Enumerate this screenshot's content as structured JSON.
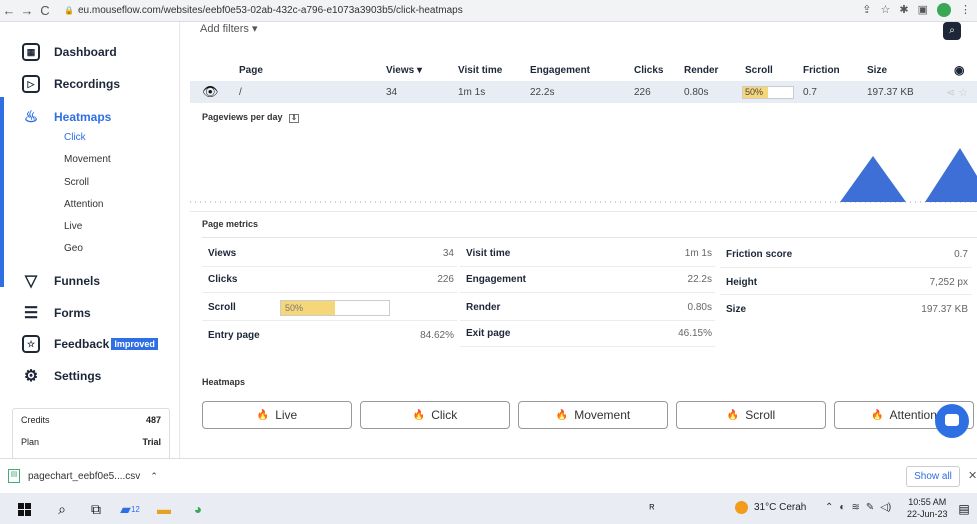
{
  "browser": {
    "url": "eu.mouseflow.com/websites/eebf0e53-02ab-432c-a796-e1073a3903b5/click-heatmaps"
  },
  "sidebar": {
    "items": [
      {
        "label": "Dashboard",
        "icon": "dashboard-icon"
      },
      {
        "label": "Recordings",
        "icon": "recordings-icon"
      },
      {
        "label": "Heatmaps",
        "icon": "heatmaps-icon"
      },
      {
        "label": "Funnels",
        "icon": "funnels-icon"
      },
      {
        "label": "Forms",
        "icon": "forms-icon"
      },
      {
        "label": "Feedback",
        "icon": "feedback-icon",
        "badge": "Improved"
      },
      {
        "label": "Settings",
        "icon": "settings-icon"
      }
    ],
    "heatmap_subitems": [
      "Click",
      "Movement",
      "Scroll",
      "Attention",
      "Live",
      "Geo"
    ],
    "credits": {
      "label": "Credits",
      "value": "487",
      "plan_label": "Plan",
      "plan_value": "Trial"
    }
  },
  "main": {
    "add_filters": "Add filters ▾",
    "table": {
      "headers": [
        "Page",
        "Views ▾",
        "Visit time",
        "Engagement",
        "Clicks",
        "Render",
        "Scroll",
        "Friction",
        "Size"
      ],
      "row": {
        "page": "/",
        "views": "34",
        "visit_time": "1m 1s",
        "engagement": "22.2s",
        "clicks": "226",
        "render": "0.80s",
        "scroll": "50%",
        "scroll_fraction": 0.5,
        "friction": "0.7",
        "size": "197.37 KB"
      }
    },
    "pageviews_title": "Pageviews per day",
    "page_metrics": {
      "title": "Page metrics",
      "col1": [
        {
          "label": "Views",
          "value": "34"
        },
        {
          "label": "Clicks",
          "value": "226"
        },
        {
          "label": "Scroll",
          "value": "50%",
          "fraction": 0.5
        },
        {
          "label": "Entry page",
          "value": "84.62%"
        }
      ],
      "col2": [
        {
          "label": "Visit time",
          "value": "1m 1s"
        },
        {
          "label": "Engagement",
          "value": "22.2s"
        },
        {
          "label": "Render",
          "value": "0.80s"
        },
        {
          "label": "Exit page",
          "value": "46.15%"
        }
      ],
      "col3": [
        {
          "label": "Friction score",
          "value": "0.7"
        },
        {
          "label": "Height",
          "value": "7,252 px"
        },
        {
          "label": "Size",
          "value": "197.37 KB"
        }
      ]
    },
    "heatmaps": {
      "title": "Heatmaps",
      "buttons": [
        "Live",
        "Click",
        "Movement",
        "Scroll",
        "Attention"
      ]
    }
  },
  "downloads": {
    "file": "pagechart_eebf0e5....csv",
    "show_all": "Show all"
  },
  "taskbar": {
    "weather": "31°C  Cerah",
    "time": "10:55 AM",
    "date": "22-Jun-23",
    "badge": "12"
  },
  "colors": {
    "accent": "#2f6fe4",
    "scroll_fill": "#f5d77a",
    "chart": "#3d6fd6"
  }
}
